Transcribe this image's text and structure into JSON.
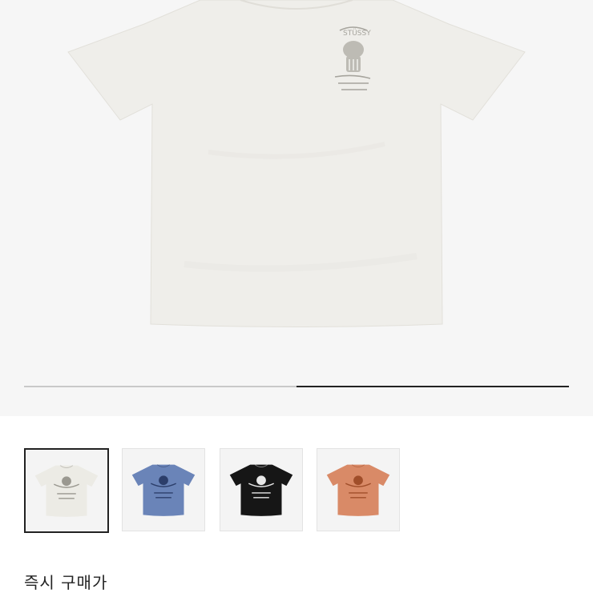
{
  "gallery": {
    "main_image": "white-tshirt-image",
    "progress": {
      "start": 0.5,
      "end": 1.0
    },
    "thumbnails": [
      {
        "name": "white",
        "color": "#ecebe5",
        "print": "#9a9890",
        "selected": true
      },
      {
        "name": "blue",
        "color": "#6a84b8",
        "print": "#2c3e6a",
        "selected": false
      },
      {
        "name": "black",
        "color": "#161616",
        "print": "#e8e8e8",
        "selected": false
      },
      {
        "name": "orange",
        "color": "#d98a67",
        "print": "#a04e2a",
        "selected": false
      }
    ]
  },
  "section": {
    "title": "즉시 구매가"
  },
  "colors": {
    "accent": "#222222",
    "track": "#c9c9c9",
    "hero_bg": "#f6f6f6"
  }
}
